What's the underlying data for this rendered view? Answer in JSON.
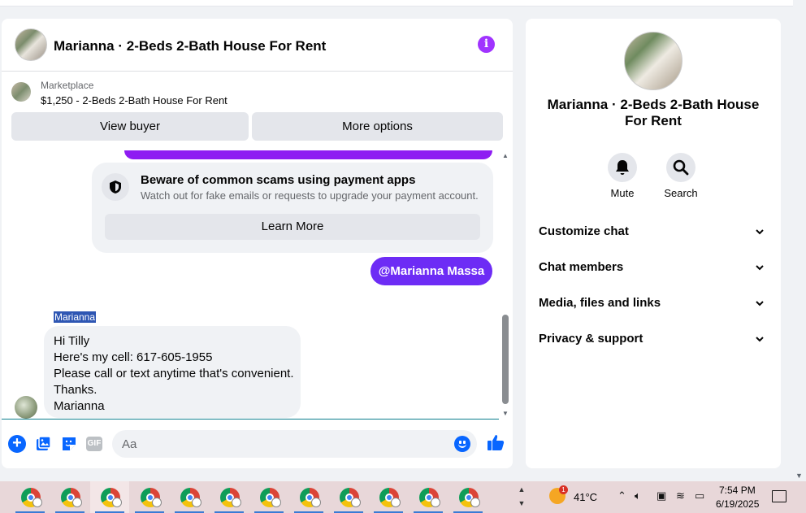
{
  "chat": {
    "title": "Marianna · 2-Beds 2-Bath House For Rent",
    "listing": {
      "source": "Marketplace",
      "price_title": "$1,250 - 2-Beds 2-Bath House For Rent"
    },
    "buttons": {
      "view_buyer": "View buyer",
      "more_options": "More options"
    },
    "scam_notice": {
      "title": "Beware of common scams using payment apps",
      "subtitle": "Watch out for fake emails or requests to upgrade your payment account.",
      "button": "Learn More"
    },
    "outgoing_mention": "@Marianna Massa",
    "incoming": {
      "sender": "Marianna",
      "lines": [
        "Hi Tilly",
        "Here's my cell: 617-605-1955",
        "Please call or text anytime that's convenient.",
        "Thanks.",
        "Marianna"
      ]
    },
    "composer": {
      "placeholder": "Aa",
      "gif_label": "GIF"
    }
  },
  "details_panel": {
    "title": "Marianna · 2-Beds 2-Bath House For Rent",
    "actions": [
      {
        "label": "Mute",
        "icon": "bell-icon"
      },
      {
        "label": "Search",
        "icon": "search-icon"
      }
    ],
    "sections": [
      "Customize chat",
      "Chat members",
      "Media, files and links",
      "Privacy & support"
    ]
  },
  "taskbar": {
    "app_count": 12,
    "weather": {
      "temp": "41°C",
      "alert_count": "1"
    },
    "clock": {
      "time": "7:54 PM",
      "date": "6/19/2025"
    }
  },
  "colors": {
    "accent_purple": "#a033ff",
    "mention_bubble": "#6d2cf5",
    "messenger_blue": "#0866ff",
    "taskbar_bg": "#e8d7d9"
  }
}
